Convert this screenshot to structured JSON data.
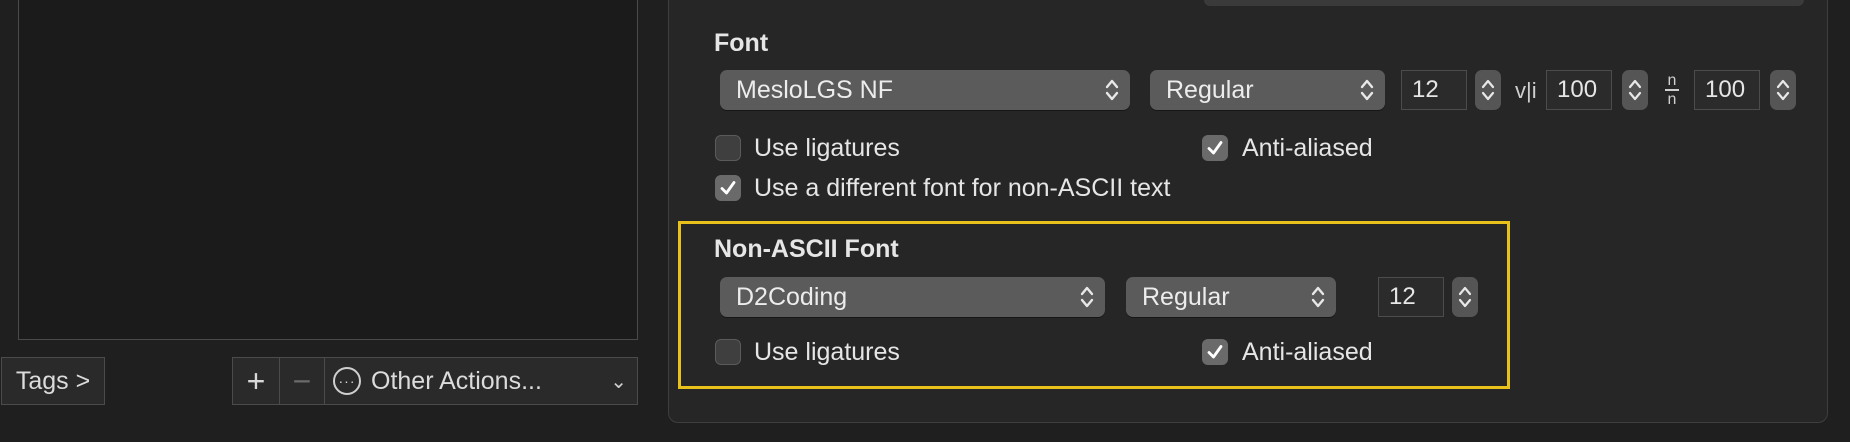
{
  "left": {
    "tags_label": "Tags >",
    "plus_label": "+",
    "minus_label": "−",
    "actions_icon": "···",
    "actions_label": "Other Actions...",
    "actions_chevron": "⌄"
  },
  "font": {
    "title": "Font",
    "family": "MesloLGS NF",
    "style": "Regular",
    "size": "12",
    "hspacing_glyph": "v|i",
    "hspacing": "100",
    "vspacing_top": "n",
    "vspacing_bottom": "n",
    "vspacing": "100",
    "use_ligatures": "Use ligatures",
    "use_ligatures_checked": false,
    "anti_aliased": "Anti-aliased",
    "anti_aliased_checked": true,
    "different_font": "Use a different font for non-ASCII text",
    "different_font_checked": true
  },
  "non_ascii_font": {
    "title": "Non-ASCII Font",
    "family": "D2Coding",
    "style": "Regular",
    "size": "12",
    "use_ligatures": "Use ligatures",
    "use_ligatures_checked": false,
    "anti_aliased": "Anti-aliased",
    "anti_aliased_checked": true
  },
  "colors": {
    "highlight": "#e8c21b",
    "popup_bg": "#5b5b5b",
    "panel_bg": "#262626"
  }
}
